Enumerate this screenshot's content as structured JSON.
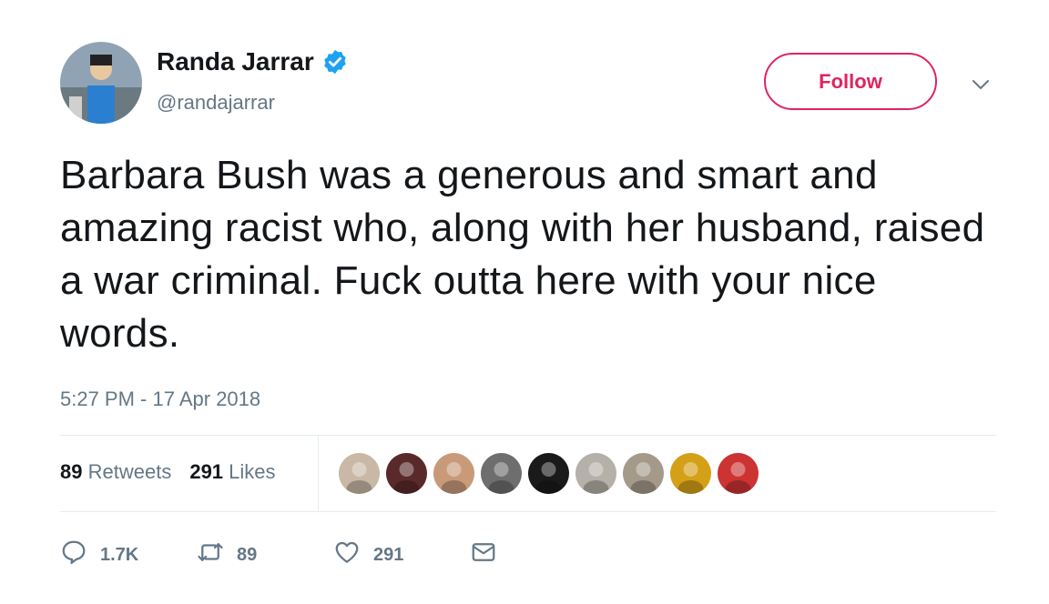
{
  "user": {
    "display_name": "Randa Jarrar",
    "handle": "@randajarrar",
    "verified_icon": "verified-badge-icon",
    "avatar_icon": "profile-avatar"
  },
  "header": {
    "follow_label": "Follow",
    "menu_icon": "chevron-down-icon"
  },
  "tweet": {
    "text": "Barbara Bush was a generous and smart and amazing racist who, along with her husband, raised a war criminal. Fuck outta here with your nice words.",
    "timestamp": "5:27 PM - 17 Apr 2018"
  },
  "stats": {
    "retweets_count": "89",
    "retweets_label": "Retweets",
    "likes_count": "291",
    "likes_label": "Likes"
  },
  "likers": [
    {
      "icon": "liker-avatar-1",
      "color": "#c9b8a6"
    },
    {
      "icon": "liker-avatar-2",
      "color": "#5a2a2a"
    },
    {
      "icon": "liker-avatar-3",
      "color": "#c99a7a"
    },
    {
      "icon": "liker-avatar-4",
      "color": "#6e6e6e"
    },
    {
      "icon": "liker-avatar-5",
      "color": "#1a1a1a"
    },
    {
      "icon": "liker-avatar-6",
      "color": "#b5b0a8"
    },
    {
      "icon": "liker-avatar-7",
      "color": "#a59a8a"
    },
    {
      "icon": "liker-avatar-8",
      "color": "#d4a017"
    },
    {
      "icon": "liker-avatar-9",
      "color": "#cc3333"
    }
  ],
  "actions": {
    "reply_count": "1.7K",
    "retweet_count": "89",
    "like_count": "291",
    "reply_icon": "reply-icon",
    "retweet_icon": "retweet-icon",
    "like_icon": "heart-icon",
    "dm_icon": "envelope-icon"
  },
  "colors": {
    "accent": "#e0245e",
    "verified": "#1da1f2",
    "muted": "#657786",
    "text": "#14171a"
  }
}
